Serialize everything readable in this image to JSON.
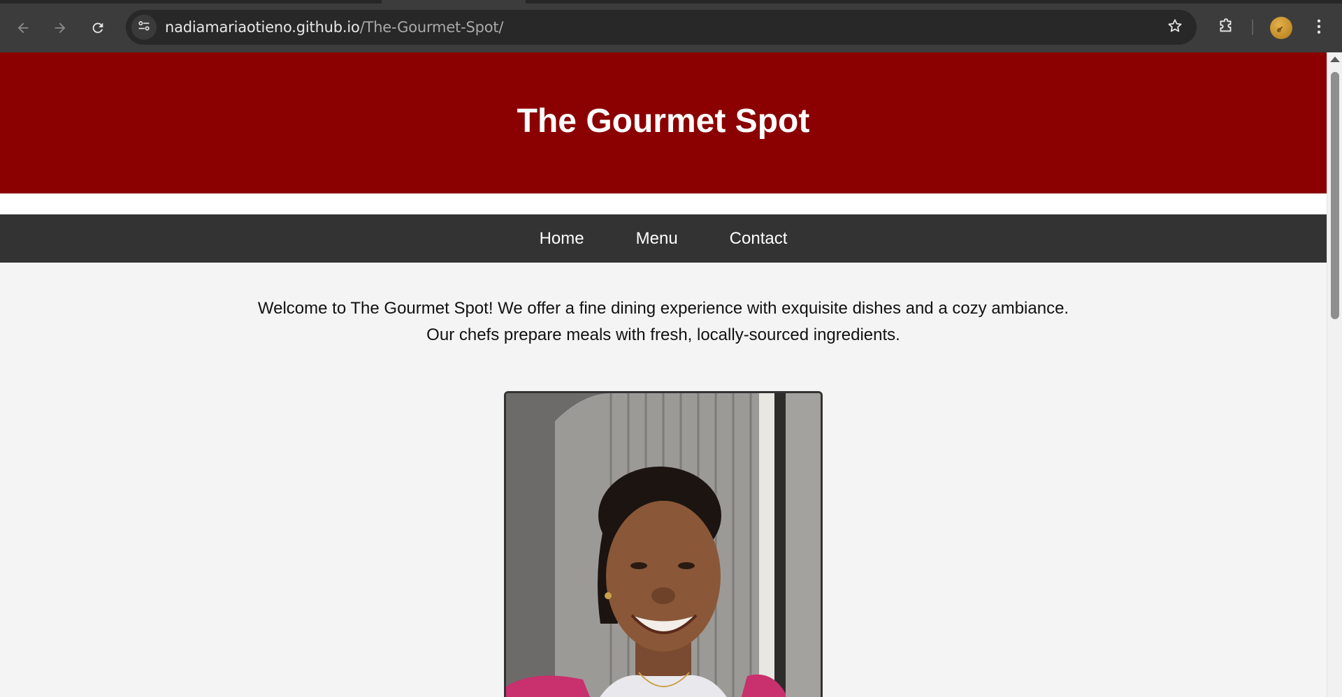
{
  "browser": {
    "url_host": "nadiamariaotieno.github.io",
    "url_path": "/The-Gourmet-Spot/",
    "icons": [
      "back-arrow-icon",
      "forward-arrow-icon",
      "reload-icon",
      "site-info-icon",
      "star-icon",
      "extensions-icon",
      "profile-avatar",
      "kebab-menu-icon"
    ]
  },
  "site": {
    "title": "The Gourmet Spot",
    "nav": {
      "home": "Home",
      "menu": "Menu",
      "contact": "Contact"
    },
    "intro_line1": "Welcome to The Gourmet Spot! We offer a fine dining experience with exquisite dishes and a cozy ambiance.",
    "intro_line2": "Our chefs prepare meals with fresh, locally-sourced ingredients."
  },
  "colors": {
    "header_bg": "#8b0000",
    "nav_bg": "#333333",
    "page_bg": "#f4f4f4",
    "chrome_bg": "#3c3c3c",
    "omnibox_bg": "#282828"
  }
}
